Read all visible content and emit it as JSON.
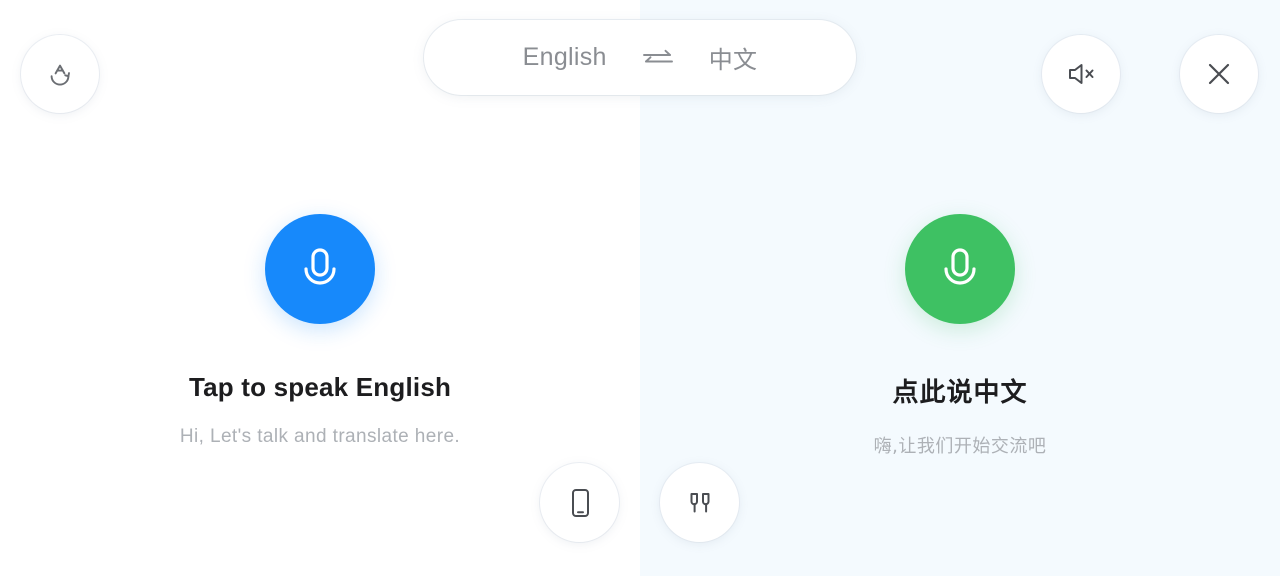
{
  "theme": {
    "bg_left": "#ffffff",
    "bg_right": "#f4fafe",
    "mic_left_color": "#1789fb",
    "mic_right_color": "#3ec163",
    "title_color": "#1d1d1f",
    "subtitle_color": "#adb1b6",
    "pill_text_color": "#8a8d92",
    "icon_color": "#5f6368"
  },
  "header": {
    "translate_button": {
      "icon": "translate-a-icon"
    },
    "language_pill": {
      "source_language": "English",
      "swap_icon": "swap-arrows-icon",
      "target_language": "中文"
    },
    "mute_button": {
      "icon": "speaker-mute-icon"
    },
    "close_button": {
      "icon": "close-icon"
    }
  },
  "panels": {
    "left": {
      "mic_icon": "microphone-icon",
      "title": "Tap to speak English",
      "subtitle": "Hi, Let's talk and translate here."
    },
    "right": {
      "mic_icon": "microphone-icon",
      "title": "点此说中文",
      "subtitle": "嗨,让我们开始交流吧"
    }
  },
  "footer": {
    "device_button": {
      "icon": "phone-icon"
    },
    "earbuds_button": {
      "icon": "earbuds-icon"
    }
  }
}
